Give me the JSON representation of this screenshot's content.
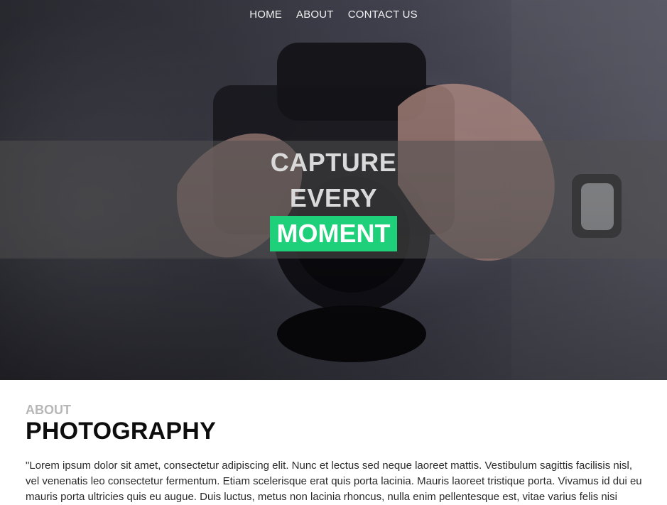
{
  "nav": {
    "items": [
      {
        "label": "HOME"
      },
      {
        "label": "ABOUT"
      },
      {
        "label": "CONTACT US"
      }
    ]
  },
  "hero": {
    "line1": "CAPTURE",
    "line2": "EVERY",
    "line3": "MOMENT",
    "accent_color": "#1ed07a"
  },
  "about": {
    "subtitle": "ABOUT",
    "title": "PHOTOGRAPHY",
    "paragraph": "\"Lorem ipsum dolor sit amet, consectetur adipiscing elit. Nunc et lectus sed neque laoreet mattis. Vestibulum sagittis facilisis nisl, vel venenatis leo consectetur fermentum. Etiam scelerisque erat quis porta lacinia. Mauris laoreet tristique porta. Vivamus id dui eu mauris porta ultricies quis eu augue. Duis luctus, metus non lacinia rhoncus, nulla enim pellentesque est, vitae varius felis nisi"
  }
}
